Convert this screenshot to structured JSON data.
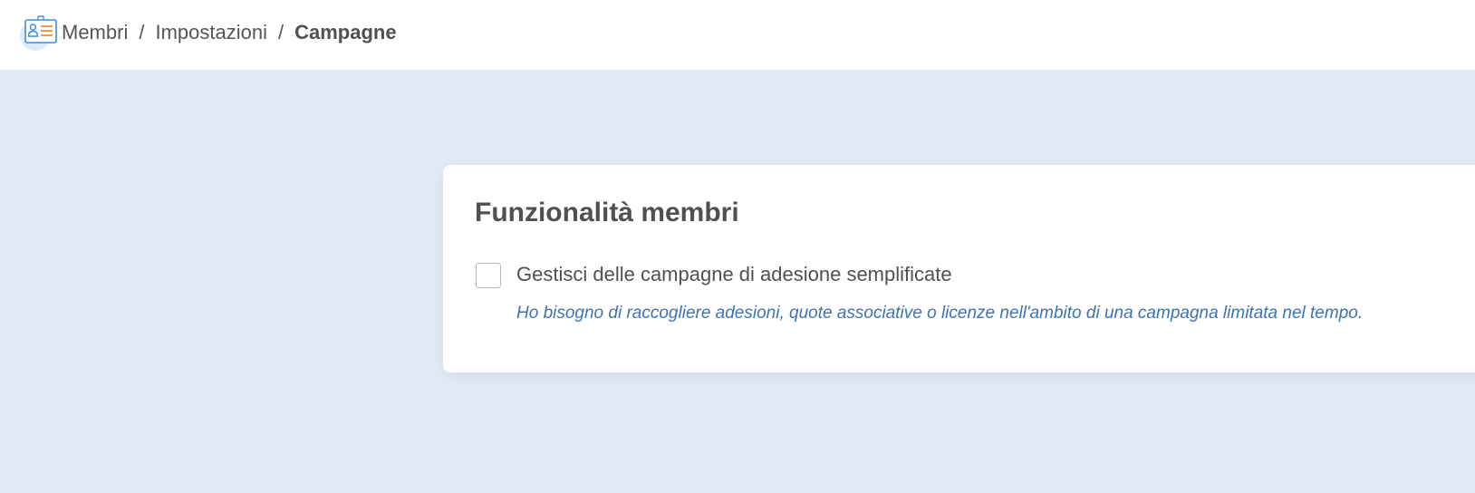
{
  "breadcrumb": {
    "icon": "member-card-icon",
    "items": [
      {
        "label": "Membri"
      },
      {
        "label": "Impostazioni"
      },
      {
        "label": "Campagne"
      }
    ],
    "separator": "/"
  },
  "card": {
    "title": "Funzionalità membri",
    "option": {
      "checked": false,
      "label": "Gestisci delle campagne di adesione semplificate",
      "help": "Ho bisogno di raccogliere adesioni, quote associative o licenze nell'ambito di una campagna limitata nel tempo."
    }
  },
  "colors": {
    "page_background": "#e3eaf6",
    "card_background": "#ffffff",
    "text": "#505050",
    "help_text": "#3c73b0",
    "icon_blue": "#3d8ed8",
    "icon_orange": "#f08c38"
  }
}
